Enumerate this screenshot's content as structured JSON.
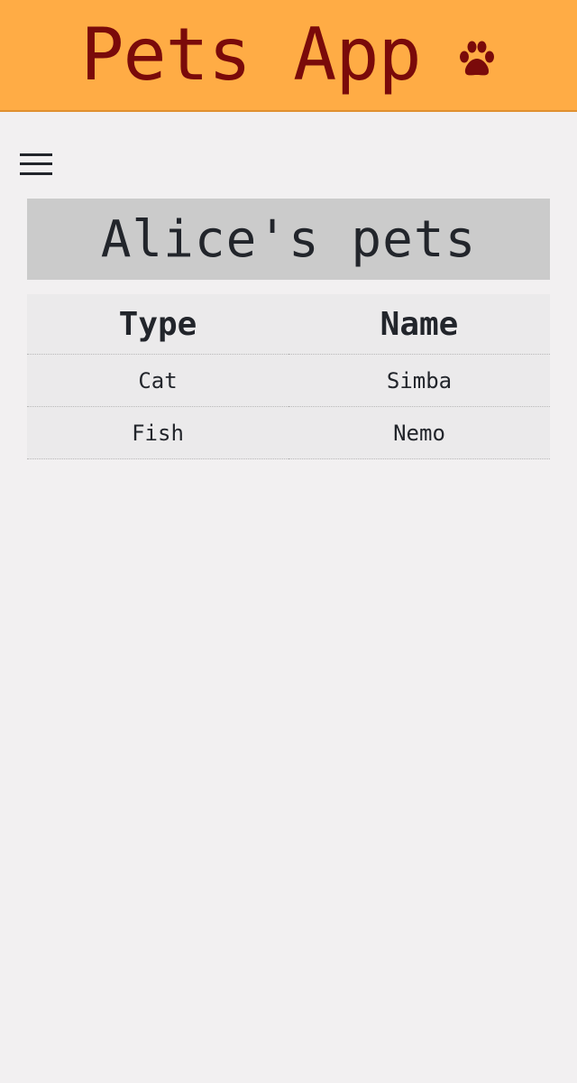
{
  "header": {
    "title": "Pets App",
    "icon": "paw-icon",
    "background": "#ffac45",
    "title_color": "#7a0a0a"
  },
  "menu": {
    "icon": "hamburger-menu-icon"
  },
  "main": {
    "heading": "Alice's pets",
    "table": {
      "columns": [
        "Type",
        "Name"
      ],
      "rows": [
        {
          "type": "Cat",
          "name": "Simba"
        },
        {
          "type": "Fish",
          "name": "Nemo"
        }
      ]
    }
  }
}
